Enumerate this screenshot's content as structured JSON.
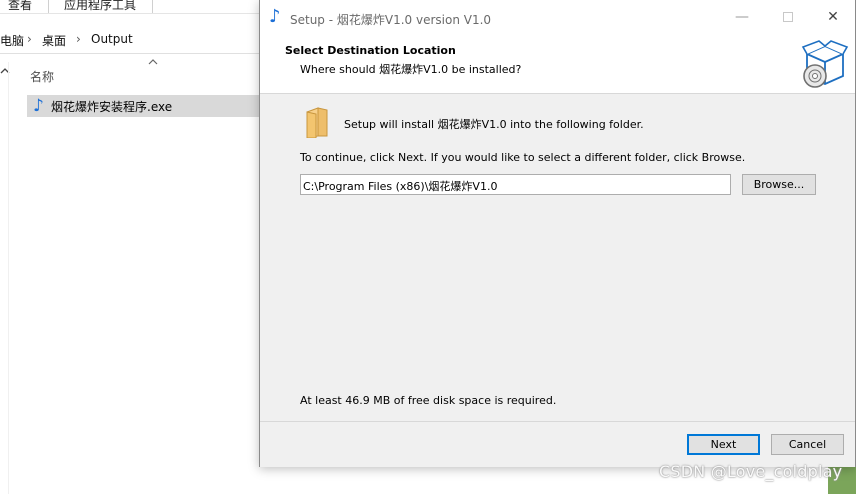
{
  "explorer": {
    "ribbon": {
      "view": "查看",
      "app_tools": "应用程序工具"
    },
    "breadcrumb": {
      "root": "电脑",
      "desktop": "桌面",
      "folder": "Output",
      "sep": "›"
    },
    "column_name": "名称",
    "file": {
      "name": "烟花爆炸安装程序.exe",
      "icon": "music-note-icon"
    }
  },
  "dialog": {
    "title": "Setup - 烟花爆炸V1.0 version V1.0",
    "title_icon": "music-note-icon",
    "heading": "Select Destination Location",
    "subheading": "Where should 烟花爆炸V1.0 be installed?",
    "install_message": "Setup will install 烟花爆炸V1.0 into the following folder.",
    "continue_message": "To continue, click Next. If you would like to select a different folder, click Browse.",
    "path_value": "C:\\Program Files (x86)\\烟花爆炸V1.0",
    "browse_label": "Browse...",
    "disk_message": "At least 46.9 MB of free disk space is required.",
    "next_label": "Next",
    "cancel_label": "Cancel",
    "accent_color": "#0078d7"
  },
  "watermark": "CSDN @Love_coldplay"
}
